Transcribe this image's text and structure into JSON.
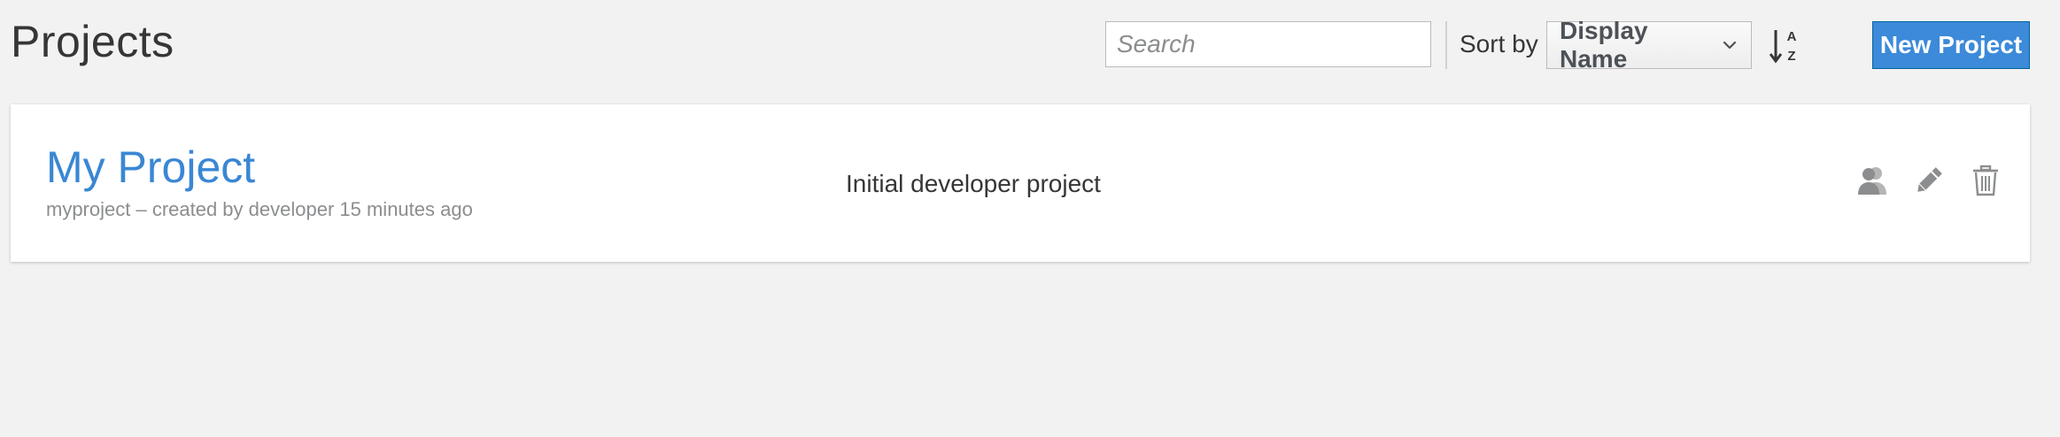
{
  "header": {
    "title": "Projects",
    "search_placeholder": "Search",
    "sort_label": "Sort by",
    "sort_selected": "Display Name",
    "sort_direction_icon": "sort-alpha-asc-icon",
    "new_project_label": "New Project"
  },
  "projects": [
    {
      "display_name": "My Project",
      "meta": "myproject – created by developer 15 minutes ago",
      "description": "Initial developer project",
      "actions": [
        "members-icon",
        "edit-icon",
        "delete-icon"
      ]
    }
  ],
  "colors": {
    "background": "#f2f2f2",
    "link": "#3a87d4",
    "primary_button": "#3c8ad9",
    "muted_text": "#8b8d8f",
    "icon": "#8b8d8f"
  }
}
